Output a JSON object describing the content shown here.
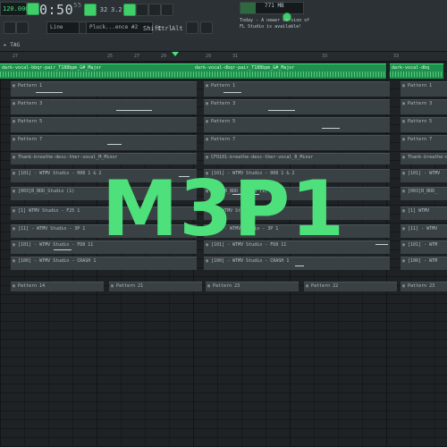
{
  "toolbar": {
    "bpm": "120.000",
    "time": "0:50",
    "time_sub": "55",
    "mode": "Line",
    "pattern_selector": "Pluck...ence #2",
    "shift_label": "Shift",
    "ctrl_label": "Ctrl",
    "alt_label": "Alt",
    "memory": "771 MB",
    "news_line1": "Today - A newer version of",
    "news_line2": "FL Studio is available!",
    "btn_32": "32",
    "btn_3_2": "3.2"
  },
  "window": {
    "title": "▸ TAG"
  },
  "ruler": {
    "ticks": [
      "27",
      "",
      "",
      "",
      "",
      "",
      "",
      "",
      "",
      "",
      "29",
      "",
      "",
      "",
      "",
      "",
      "",
      "",
      "",
      "33",
      "",
      "",
      "",
      "",
      "",
      "",
      "",
      "",
      "",
      "",
      "",
      "",
      "35"
    ]
  },
  "tracks": {
    "audio_top": [
      {
        "label": "dark-vocal-bbqr-pair_T188bpm_G#_Major"
      },
      {
        "label": "dark-vocal-dbqr-pair_T188bpm_G#_Major"
      },
      {
        "label": "dark-vocal-dbq"
      }
    ],
    "patterns": [
      {
        "label": "Pattern 1"
      },
      {
        "label": "Pattern 1"
      },
      {
        "label": "Pattern 1"
      },
      {
        "label": "Pattern 3"
      },
      {
        "label": "Pattern 3"
      },
      {
        "label": "Pattern 3"
      },
      {
        "label": "Pattern 5"
      },
      {
        "label": "Pattern 5"
      },
      {
        "label": "Pattern 5"
      },
      {
        "label": "Pattern 7"
      },
      {
        "label": "Pattern 7"
      },
      {
        "label": "Pattern 7"
      }
    ],
    "audio_mid": [
      {
        "label": "Thank-breathe-desc-ther-vocal_M_Minor"
      },
      {
        "label": "CFO101-breathe-desc-ther-vocal_B_Minor"
      },
      {
        "label": "Thank-breathe-desc-ther"
      }
    ],
    "inst_rows": [
      {
        "label": "[101] - WTMV Studio - 008 1 & 2"
      },
      {
        "label": "[101] - WTMV Studio - 008 1 & 2"
      },
      {
        "label": "[101] - WTMV"
      },
      {
        "label": "[003]B_BDD_Studio (1)"
      },
      {
        "label": "[003]B_BDD_Studio (1)"
      },
      {
        "label": "[003]B_BDD_"
      },
      {
        "label": "[1] WTMV Studio - F25 1"
      },
      {
        "label": "[1] WTMV Studio - F25 1"
      },
      {
        "label": "[1] WTMV"
      },
      {
        "label": "[11] - WTMV Studio - 3P 1"
      },
      {
        "label": "[11] - WTMV Studio - 3P 1"
      },
      {
        "label": "[11] - WTMV"
      },
      {
        "label": "[101] - WTMV Studio - FD8 11"
      },
      {
        "label": "[101] - WTMV Studio - FD8 11"
      },
      {
        "label": "[101] - WTM"
      },
      {
        "label": "[100] - WTMV Studio - CRASH 1"
      },
      {
        "label": "[100] - WTMV Studio - CRASH 1"
      },
      {
        "label": "[100] - WTM"
      }
    ],
    "bottom_patterns": [
      {
        "label": "Pattern 14"
      },
      {
        "label": "Pattern 21"
      },
      {
        "label": "Pattern 23"
      },
      {
        "label": "Pattern 22"
      },
      {
        "label": "Pattern 23"
      }
    ]
  },
  "watermark": {
    "text": "M3P1"
  },
  "colors": {
    "accent": "#4de07b",
    "audio_clip": "#1f8f4d",
    "pattern_clip": "#394145",
    "background": "#1e2225"
  }
}
